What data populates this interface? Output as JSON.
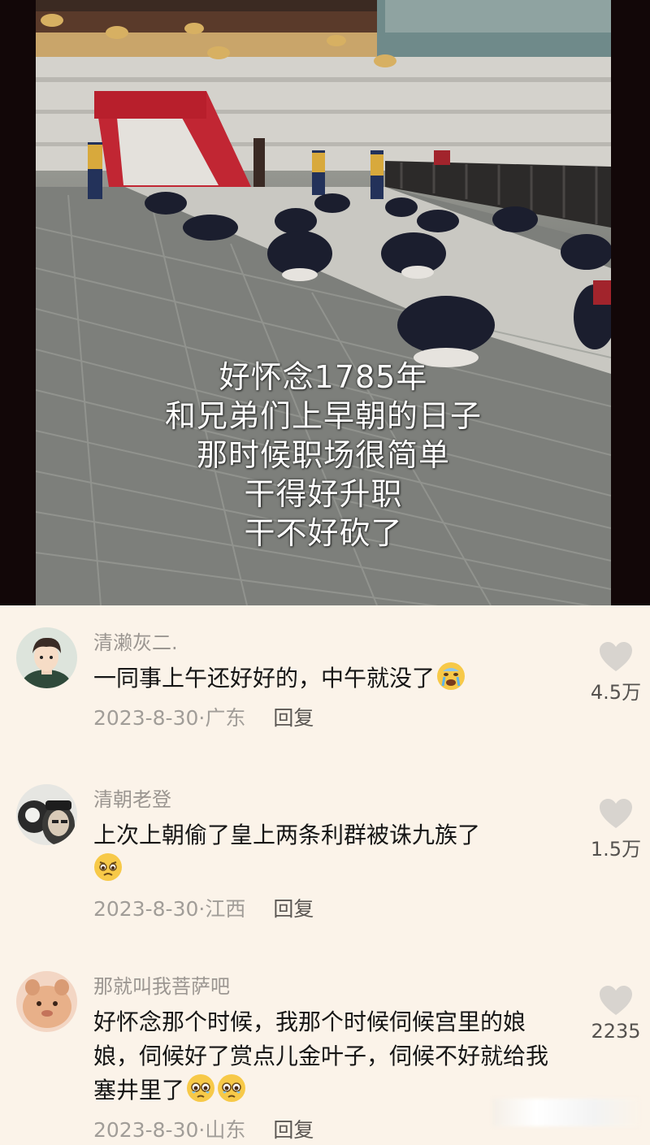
{
  "video": {
    "caption_lines": [
      "好怀念1785年",
      "和兄弟们上早朝的日子",
      "那时候职场很简单",
      "干得好升职",
      "干不好砍了"
    ]
  },
  "comments": [
    {
      "username": "清濑灰二.",
      "text": "一同事上午还好好的，中午就没了",
      "emojis": [
        "crying-face"
      ],
      "date": "2023-8-30",
      "location": "广东",
      "reply_label": "回复",
      "likes": "4.5万"
    },
    {
      "username": "清朝老登",
      "text": "上次上朝偷了皇上两条利群被诛九族了",
      "emojis": [
        "pleading-face"
      ],
      "date": "2023-8-30",
      "location": "江西",
      "reply_label": "回复",
      "likes": "1.5万"
    },
    {
      "username": "那就叫我菩萨吧",
      "text": "好怀念那个时候，我那个时候伺候宫里的娘娘，伺候好了赏点儿金叶子，伺候不好就给我塞井里了",
      "emojis": [
        "teary-face",
        "teary-face"
      ],
      "date": "2023-8-30",
      "location": "山东",
      "reply_label": "回复",
      "likes": "2235"
    }
  ],
  "meta_separator": "·",
  "colors": {
    "background": "#fbf3e9",
    "username": "#9b9691",
    "text": "#161616",
    "heart": "#d8d4cf"
  }
}
